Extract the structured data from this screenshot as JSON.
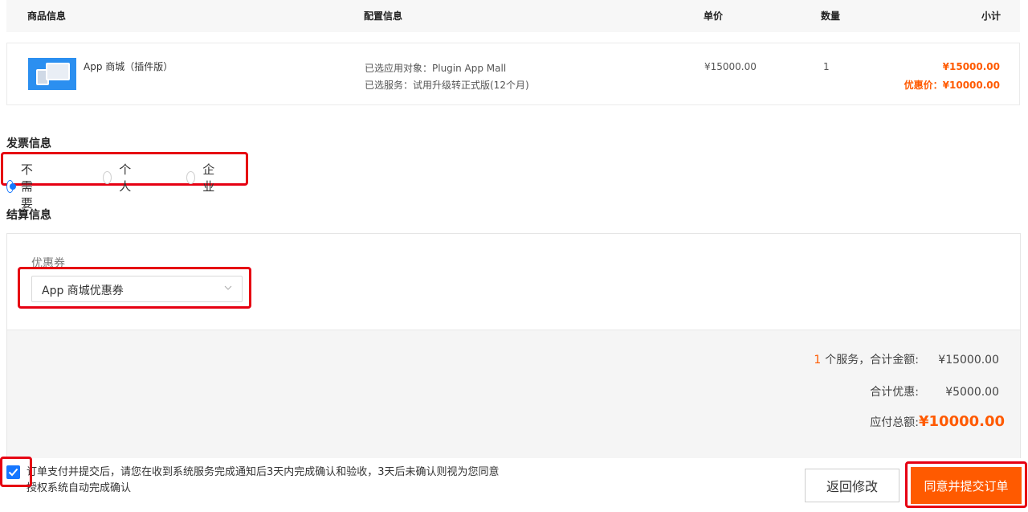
{
  "table_header": {
    "product": "商品信息",
    "config": "配置信息",
    "unit_price": "单价",
    "quantity": "数量",
    "subtotal": "小计"
  },
  "product": {
    "name": "App 商城（插件版）",
    "config_target": "已选应用对象：Plugin App Mall",
    "config_service": "已选服务：试用升级转正式版(12个月)",
    "unit_price": "¥15000.00",
    "quantity": "1",
    "subtotal": "¥15000.00",
    "discount_price": "优惠价：¥10000.00"
  },
  "invoice": {
    "title": "发票信息",
    "options": [
      "不需要",
      "个人",
      "企业"
    ],
    "selected": "不需要"
  },
  "settlement": {
    "title": "结算信息",
    "coupon_label": "优惠券",
    "coupon_value": "App 商城优惠券",
    "service_count": "1",
    "service_label": "个服务，合计金额:",
    "total_amount": "¥15000.00",
    "discount_label": "合计优惠:",
    "discount_amount": "¥5000.00",
    "payable_label": "应付总额:",
    "payable_amount": "¥10000.00"
  },
  "agreement": {
    "checked": true,
    "line1": "订单支付并提交后，请您在收到系统服务完成通知后3天内完成确认和验收，3天后未确认则视为您同意",
    "line2": "授权系统自动完成确认"
  },
  "actions": {
    "back_label": "返回修改",
    "submit_label": "同意并提交订单"
  },
  "colors": {
    "accent": "#ff5a00",
    "primary": "#1677ff",
    "highlight": "#e60012"
  }
}
